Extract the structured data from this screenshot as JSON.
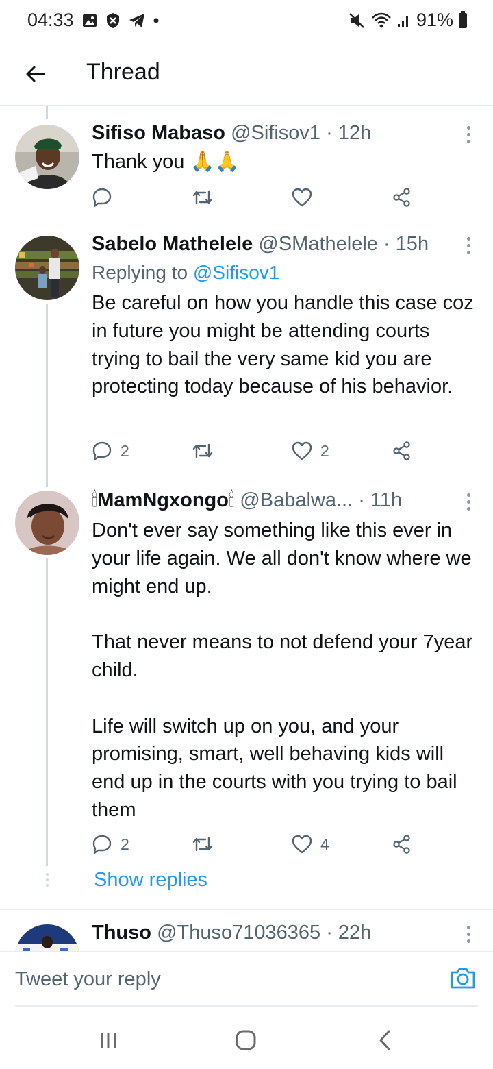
{
  "status_bar": {
    "time": "04:33",
    "left_icons": [
      "gallery-icon",
      "shield-icon",
      "telegram-icon",
      "dot-icon"
    ],
    "battery": "91%",
    "right_icons": [
      "mute-icon",
      "wifi-icon",
      "signal-icon",
      "battery-icon"
    ]
  },
  "header": {
    "title": "Thread",
    "back_icon": "arrow-left-icon"
  },
  "tweets": [
    {
      "name": "Sifiso Mabaso",
      "handle": "@Sifisov1",
      "time": "· 12h",
      "text": "Thank you 🙏🙏",
      "reply_count": "",
      "like_count": ""
    },
    {
      "name": "Sabelo Mathelele",
      "handle": "@SMathelele",
      "time": "· 15h",
      "replying_prefix": "Replying to ",
      "replying_to": "@Sifisov1",
      "text": "Be careful on how you handle this case coz in future you might be attending courts trying to bail the very same kid you are protecting today because of his behavior.",
      "reply_count": "2",
      "like_count": "2"
    },
    {
      "name": "MamNgxongo",
      "handle": "@Babalwa...",
      "time": "· 11h",
      "name_emoji": "🕯",
      "text": "Don't ever say something like this ever in your life again. We all don't know where we might end up.\n\nThat never means to not defend your 7year child.\n\nLife will switch up on you, and your promising, smart, well behaving kids will end up in the courts with you trying to bail them",
      "reply_count": "2",
      "like_count": "4",
      "show_replies": "Show replies"
    },
    {
      "name": "Thuso",
      "handle": "@Thuso71036365",
      "time": "· 22h"
    }
  ],
  "composer": {
    "placeholder": "Tweet your reply",
    "camera_icon": "camera-icon"
  },
  "nav_bar": {
    "icons": [
      "recents-icon",
      "home-icon",
      "back-icon"
    ]
  },
  "colors": {
    "accent": "#1d9bf0",
    "text": "#0f1419",
    "muted": "#536471",
    "divider": "#e6ecf0"
  }
}
